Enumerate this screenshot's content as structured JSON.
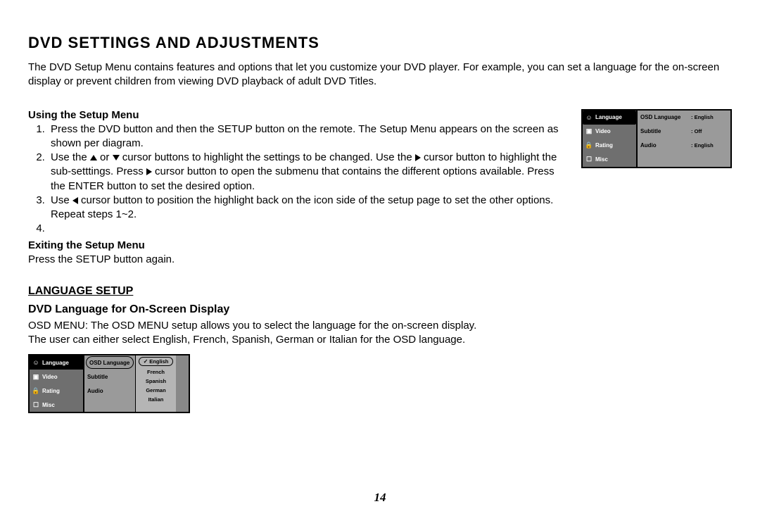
{
  "title": "DVD SETTINGS AND ADJUSTMENTS",
  "intro": "The DVD Setup Menu contains features and options that let you customize your DVD player. For example, you can set a language for the on-screen display or prevent children from viewing DVD playback of adult DVD Titles.",
  "using": {
    "heading": "Using the Setup Menu",
    "step1": "Press the DVD button and then the SETUP button on the remote. The Setup Menu appears on the screen as shown per diagram.",
    "step2a": "Use the ",
    "step2b": " or ",
    "step2c": " cursor buttons to highlight the settings to be changed. Use the ",
    "step2d": " cursor button to highlight the sub-setttings. Press ",
    "step2e": " cursor button to open the submenu that contains the different options available.  Press the ENTER button to set the desired option.",
    "step3a": "Use ",
    "step3b": " cursor button to position the highlight back on the icon side of the setup page to set the other options. Repeat steps 1~2.",
    "step4": ""
  },
  "exiting": {
    "heading": "Exiting the Setup Menu",
    "text": "Press the SETUP button again."
  },
  "lang_setup": {
    "heading": "LANGUAGE SETUP",
    "sub": "DVD Language for On-Screen Display",
    "p1": "OSD MENU: The OSD MENU setup allows you to select the language for the on-screen display.",
    "p2": "The user can either select English, French, Spanish, German or Italian for the OSD language."
  },
  "osd1": {
    "left": [
      "Language",
      "Video",
      "Rating",
      "Misc"
    ],
    "mid": [
      "OSD Language",
      "Subtitle",
      "Audio"
    ],
    "right": [
      ": English",
      ": Off",
      ": English"
    ]
  },
  "osd2": {
    "left": [
      "Language",
      "Video",
      "Rating",
      "Misc"
    ],
    "mid": [
      "OSD Language",
      "Subtitle",
      "Audio"
    ],
    "options": [
      "English",
      "French",
      "Spanish",
      "German",
      "Italian"
    ]
  },
  "page_number": "14"
}
